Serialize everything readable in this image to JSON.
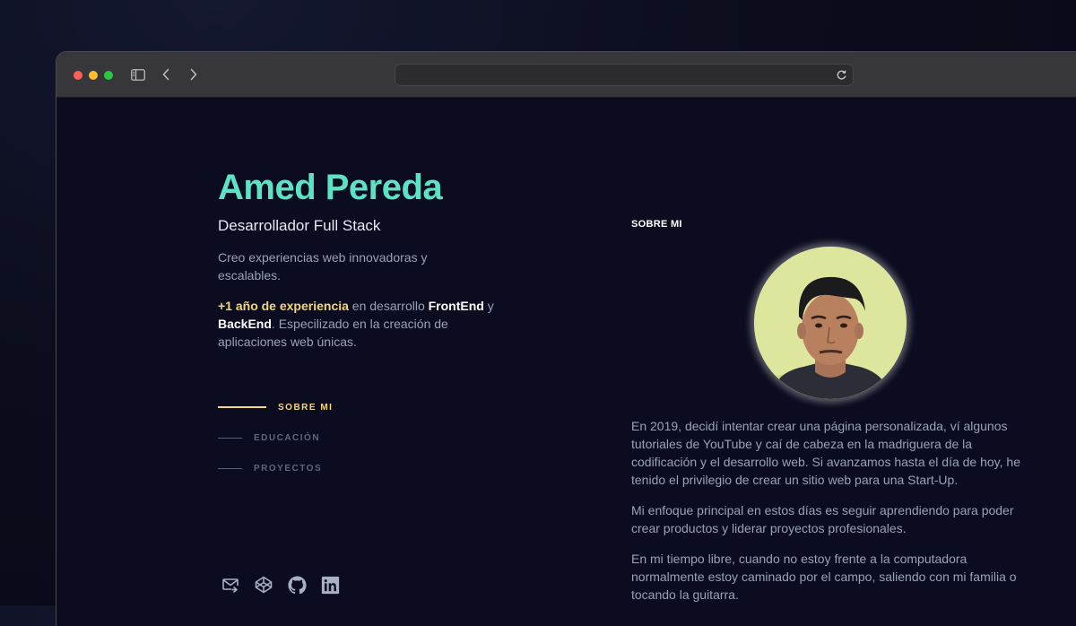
{
  "profile": {
    "name": "Amed Pereda",
    "role": "Desarrollador Full Stack",
    "description": "Creo experiencias web innovadoras y escalables.",
    "experience": {
      "highlight": "+1 año de experiencia",
      "text_1": " en desarrollo ",
      "frontend": "FrontEnd",
      "text_2": " y ",
      "backend": "BackEnd",
      "text_3": ". Especilizado en la creación de aplicaciones web únicas."
    }
  },
  "nav": {
    "items": [
      {
        "label": "SOBRE MI",
        "active": true
      },
      {
        "label": "EDUCACIÓN",
        "active": false
      },
      {
        "label": "PROYECTOS",
        "active": false
      }
    ]
  },
  "socials": [
    "mail-icon",
    "codepen-icon",
    "github-icon",
    "linkedin-icon"
  ],
  "about": {
    "title": "SOBRE MI",
    "paragraphs": [
      "En 2019, decidí intentar crear una página personalizada, ví algunos tutoriales de YouTube y caí de cabeza en la madriguera de la codificación y el desarrollo web. Si avanzamos hasta el día de hoy, he tenido el privilegio de crear un sitio web para una Start-Up.",
      "Mi enfoque principal en estos días es seguir aprendiendo para poder crear productos y liderar proyectos profesionales.",
      "En mi tiempo libre, cuando no estoy frente a la computadora normalmente estoy caminado por el campo, saliendo con mi familia o tocando la guitarra."
    ]
  },
  "colors": {
    "accent": "#5ee2c6",
    "highlight": "#f3d77a",
    "background": "#0b0c1f"
  }
}
